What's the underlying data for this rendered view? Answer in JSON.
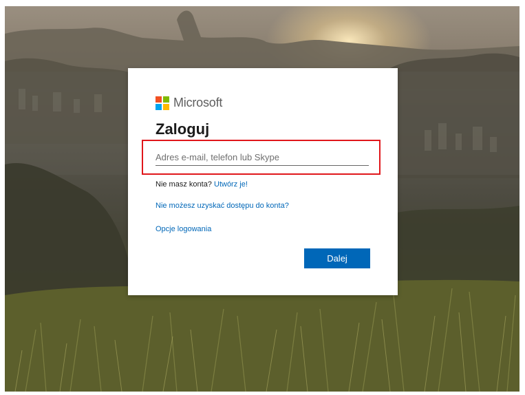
{
  "brand": {
    "name": "Microsoft",
    "logo_colors": [
      "#f25022",
      "#7fba00",
      "#00a4ef",
      "#ffb900"
    ]
  },
  "signin": {
    "title": "Zaloguj",
    "email_placeholder": "Adres e-mail, telefon lub Skype",
    "email_value": "",
    "no_account_text": "Nie masz konta?",
    "create_link": "Utwórz je!",
    "cant_access_link": "Nie możesz uzyskać dostępu do konta?",
    "signin_options_link": "Opcje logowania",
    "next_button": "Dalej"
  },
  "colors": {
    "accent": "#0067b8",
    "highlight_border": "#e0161b"
  }
}
